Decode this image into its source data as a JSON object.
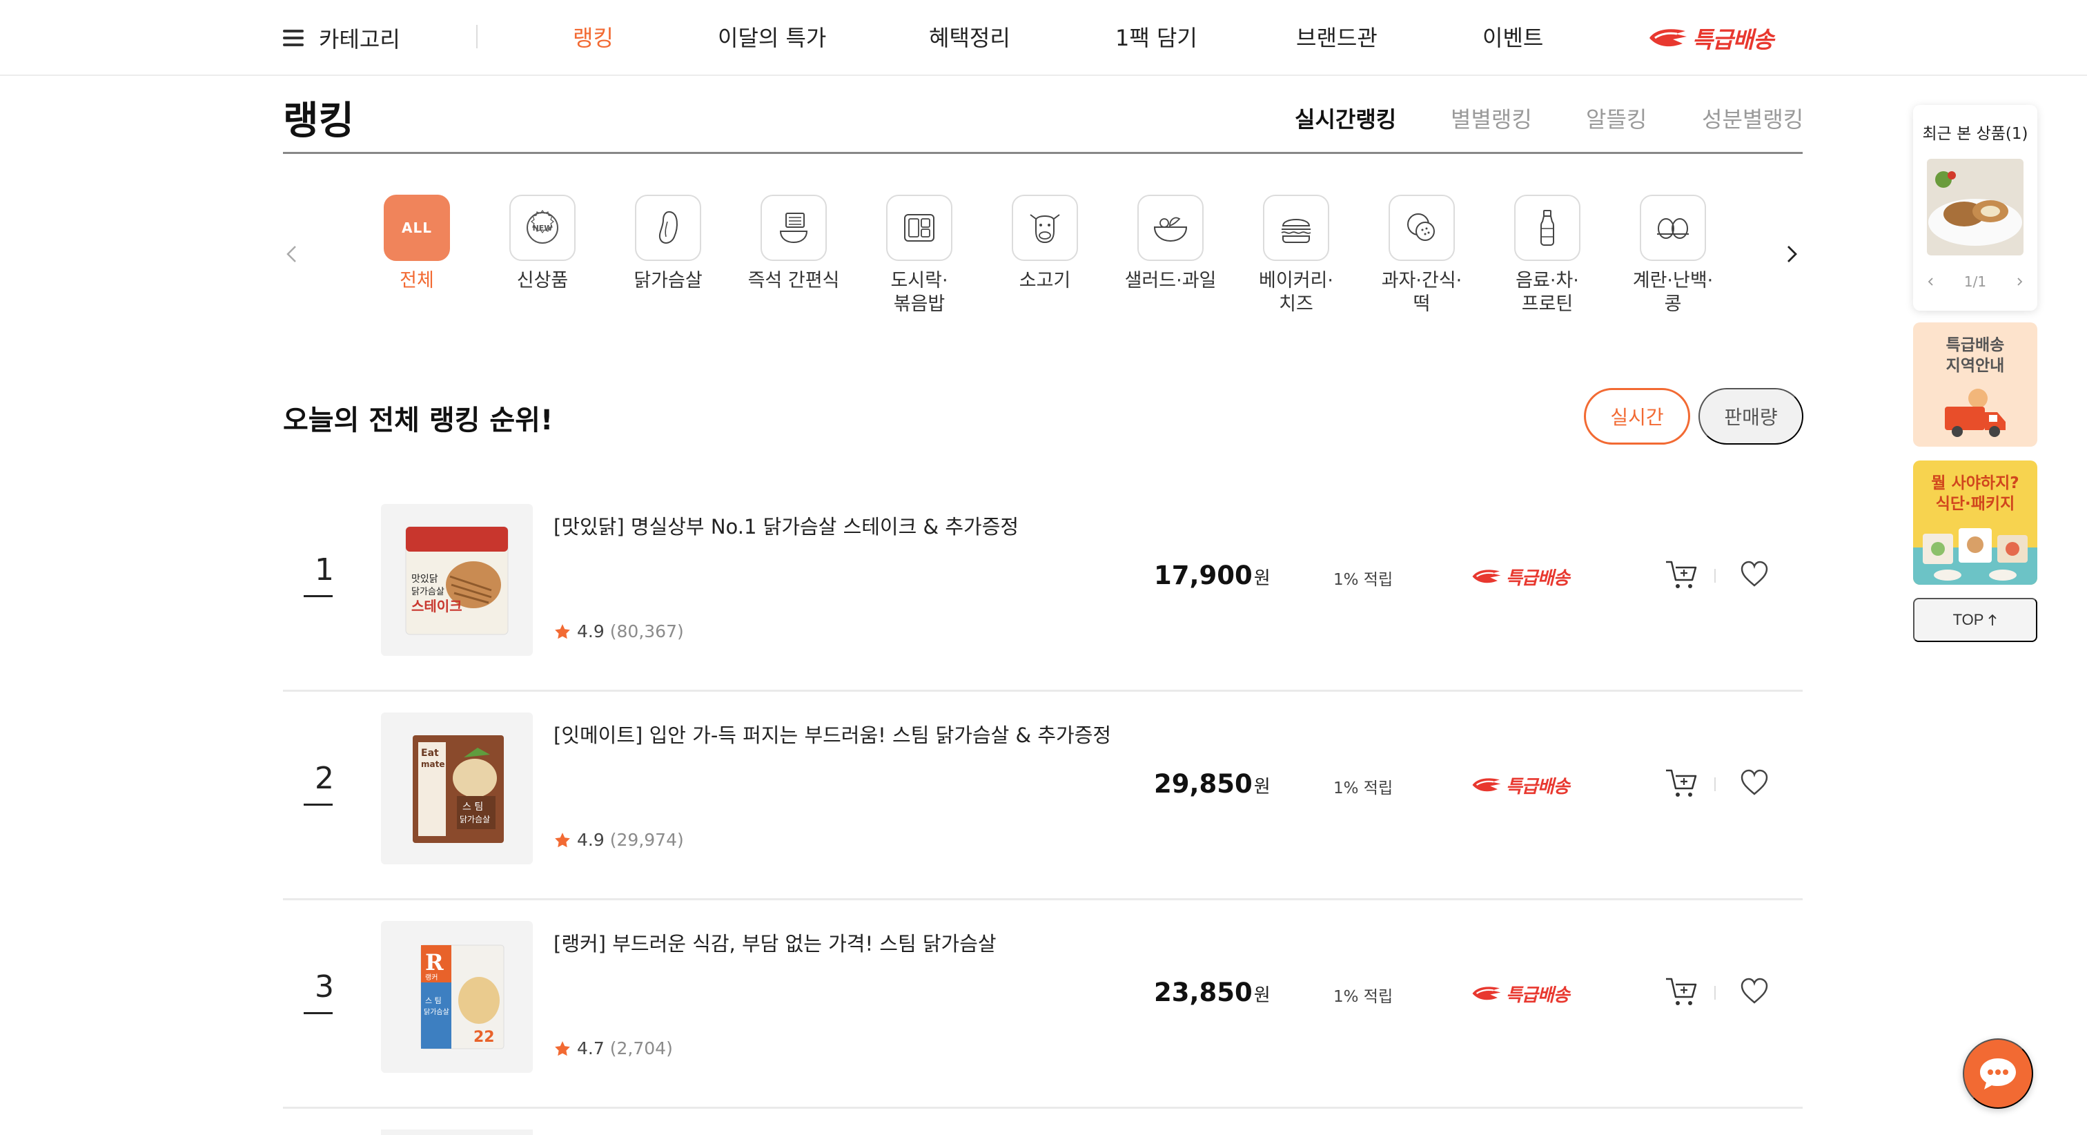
{
  "nav": {
    "category_label": "카테고리",
    "items": [
      "랭킹",
      "이달의 특가",
      "혜택정리",
      "1팩 담기",
      "브랜드관",
      "이벤트"
    ],
    "express_label": "특급배송",
    "colors": {
      "accent": "#f26a33",
      "express": "#e8382f"
    }
  },
  "page": {
    "title": "랭킹",
    "rank_tabs": [
      "실시간랭킹",
      "별별랭킹",
      "알뜰킹",
      "성분별랭킹"
    ]
  },
  "categories": [
    {
      "label": "전체",
      "icon": "all-icon",
      "badge": "ALL"
    },
    {
      "label": "신상품",
      "icon": "new-badge-icon",
      "badge": "NEW"
    },
    {
      "label": "닭가슴살",
      "icon": "chicken-breast-icon"
    },
    {
      "label": "즉석 간편식",
      "icon": "instant-meal-icon"
    },
    {
      "label": "도시락·\n볶음밥",
      "icon": "lunchbox-icon"
    },
    {
      "label": "소고기",
      "icon": "cow-icon"
    },
    {
      "label": "샐러드·과일",
      "icon": "salad-icon"
    },
    {
      "label": "베이커리·\n치즈",
      "icon": "burger-icon"
    },
    {
      "label": "과자·간식·\n떡",
      "icon": "snack-icon"
    },
    {
      "label": "음료·차·\n프로틴",
      "icon": "bottle-icon"
    },
    {
      "label": "계란·난백·\n콩",
      "icon": "egg-icon"
    }
  ],
  "section": {
    "title": "오늘의 전체 랭킹 순위!",
    "filter_on": "실시간",
    "filter_off": "판매량"
  },
  "products": [
    {
      "rank": "1",
      "name": "[맛있닭] 명실상부 No.1 닭가슴살 스테이크 & 추가증정",
      "rating": "4.9",
      "reviews": "(80,367)",
      "price": "17,900",
      "unit": "원",
      "points": "1% 적립",
      "express": "특급배송"
    },
    {
      "rank": "2",
      "name": "[잇메이트] 입안 가-득 퍼지는 부드러움! 스팀 닭가슴살 & 추가증정",
      "rating": "4.9",
      "reviews": "(29,974)",
      "price": "29,850",
      "unit": "원",
      "points": "1% 적립",
      "express": "특급배송"
    },
    {
      "rank": "3",
      "name": "[랭커] 부드러운 식감, 부담 없는 가격! 스팀 닭가슴살",
      "rating": "4.7",
      "reviews": "(2,704)",
      "price": "23,850",
      "unit": "원",
      "points": "1% 적립",
      "express": "특급배송"
    }
  ],
  "package_labels": {
    "p1": [
      "맛있닭",
      "닭가슴살",
      "스테이크"
    ],
    "p2": [
      "Eat",
      "mate",
      "스 팀",
      "닭가슴살"
    ],
    "p3": [
      "R",
      "랭커",
      "스 팀",
      "닭가슴살",
      "22"
    ]
  },
  "sidebar": {
    "recent_title": "최근 본 상품(1)",
    "recent_pager": "1/1",
    "banner1": "특급배송\n지역안내",
    "banner2": "뭘 사야하지?\n식단·패키지",
    "top_label": "TOP"
  }
}
